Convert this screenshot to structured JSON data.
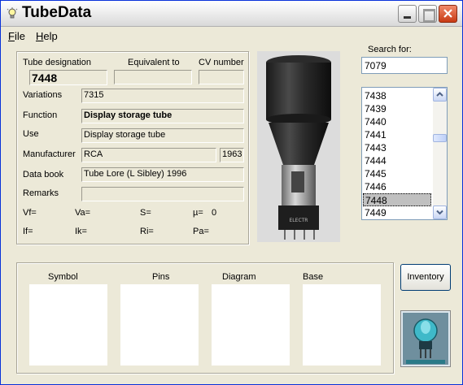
{
  "window": {
    "title": "TubeData"
  },
  "menu": [
    {
      "label": "File",
      "mnemonic": "F",
      "rest": "ile"
    },
    {
      "label": "Help",
      "mnemonic": "H",
      "rest": "elp"
    }
  ],
  "fields": {
    "tube_designation_label": "Tube designation",
    "tube_designation_value": "7448",
    "equivalent_to_label": "Equivalent to",
    "equivalent_to_value": "",
    "cv_number_label": "CV number",
    "cv_number_value": "",
    "variations_label": "Variations",
    "variations_value": "7315",
    "function_label": "Function",
    "function_value": "Display storage tube",
    "use_label": "Use",
    "use_value": "Display storage tube",
    "manufacturer_label": "Manufacturer",
    "manufacturer_value": "RCA",
    "year_value": "1963",
    "data_book_label": "Data book",
    "data_book_value": "Tube Lore (L Sibley) 1996",
    "remarks_label": "Remarks",
    "remarks_value": ""
  },
  "params": {
    "vf": "Vf=",
    "va": "Va=",
    "s": "S=",
    "mu": "µ=",
    "mu_value": "0",
    "if": "If=",
    "ik": "Ik=",
    "ri": "Ri=",
    "pa": "Pa="
  },
  "search": {
    "label": "Search for:",
    "value": "7079"
  },
  "list": {
    "items": [
      "7438",
      "7439",
      "7440",
      "7441",
      "7443",
      "7444",
      "7445",
      "7446",
      "7448",
      "7449"
    ],
    "selected": "7448"
  },
  "panels": {
    "symbol": "Symbol",
    "pins": "Pins",
    "diagram": "Diagram",
    "base": "Base"
  },
  "buttons": {
    "inventory": "Inventory"
  },
  "colors": {
    "window_bg": "#ece9d8",
    "selection": "#c0c0c0",
    "close_button": "#c83a14"
  }
}
